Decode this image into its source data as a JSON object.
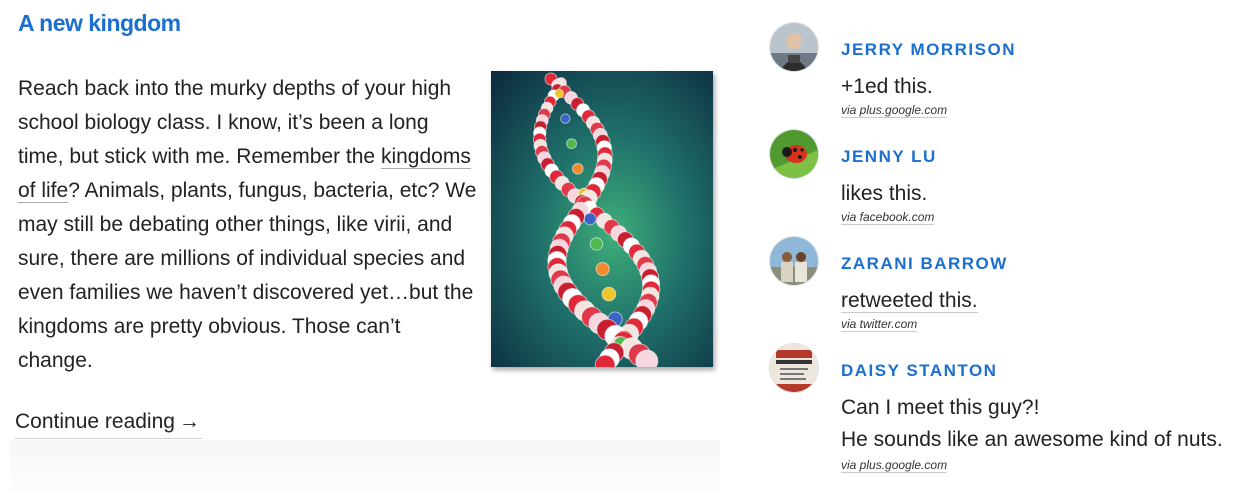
{
  "post": {
    "title": "A new kingdom",
    "paragraph_before_link": "Reach back into the murky depths of your high school biology class. I know, it’s been a long time, but stick with me. Remember the ",
    "link_text": "kingdoms of life",
    "paragraph_after_link": "? Animals, plants, fungus, bacteria, etc? We may still be debating other things, like virii, and sure, there are millions of individual species and even families we haven’t discovered yet…but the kingdoms are pretty obvious. Those can’t change.",
    "image_icon": "dna-helix-photo",
    "continue_label": "Continue reading",
    "continue_arrow": "→"
  },
  "activity": [
    {
      "name": "JERRY MORRISON",
      "action": "+1ed this.",
      "source": "via plus.google.com",
      "avatar_icon": "person-avatar"
    },
    {
      "name": "JENNY LU",
      "action": "likes this.",
      "source": "via facebook.com",
      "avatar_icon": "ladybug-avatar"
    },
    {
      "name": "ZARANI BARROW",
      "action": "retweeted this.",
      "source": "via twitter.com",
      "avatar_icon": "group-photo-avatar"
    },
    {
      "name": "DAISY STANTON",
      "action_line1": "Can I meet this guy?!",
      "action_line2": "He sounds like an awesome kind of nuts.",
      "source": "via plus.google.com",
      "avatar_icon": "drink-coffee-sign-avatar"
    }
  ],
  "colors": {
    "accent": "#1a6fd0",
    "text": "#222222"
  }
}
